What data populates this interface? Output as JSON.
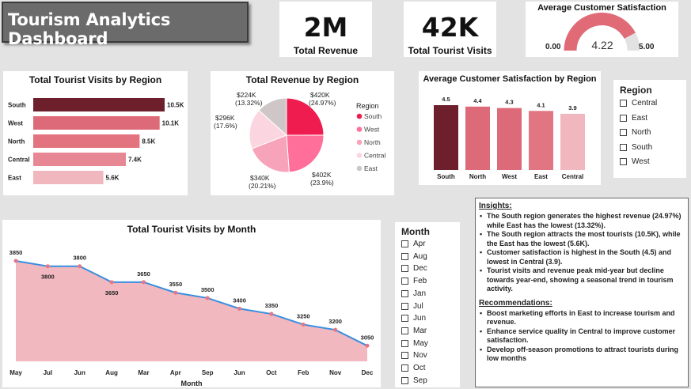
{
  "header": {
    "title": "Tourism Analytics Dashboard"
  },
  "kpis": [
    {
      "value": "2M",
      "label": "Total Revenue"
    },
    {
      "value": "42K",
      "label": "Total Tourist Visits"
    }
  ],
  "gauge": {
    "title": "Average Customer Satisfaction",
    "value": 4.22,
    "value_label": "4.22",
    "min_label": "0.00",
    "max_label": "5.00",
    "min": 0,
    "max": 5,
    "fill_color": "#e06b77",
    "track_color": "#e2e2e2"
  },
  "region_slicer": {
    "title": "Region",
    "items": [
      "Central",
      "East",
      "North",
      "South",
      "West"
    ]
  },
  "month_slicer": {
    "title": "Month",
    "items": [
      "Apr",
      "Aug",
      "Dec",
      "Feb",
      "Jan",
      "Jul",
      "Jun",
      "Mar",
      "May",
      "Nov",
      "Oct",
      "Sep"
    ]
  },
  "insights": {
    "title": "Insights:",
    "items": [
      "The South region generates the highest revenue (24.97%) while East has the lowest (13.32%).",
      "The South region attracts the most tourists (10.5K), while the East has the lowest (5.6K).",
      "Customer satisfaction is highest in the South (4.5) and lowest in Central (3.9).",
      "Tourist visits and revenue peak mid-year but decline towards year-end, showing a seasonal trend in tourism activity."
    ],
    "rec_title": "Recommendations:",
    "recs": [
      "Boost marketing efforts in East to increase tourism and revenue.",
      "Enhance service quality in Central to improve customer satisfaction.",
      "Develop off-season promotions to attract tourists during low months"
    ]
  },
  "chart_data": [
    {
      "id": "visits_by_region",
      "type": "bar",
      "orientation": "horizontal",
      "title": "Total Tourist Visits by Region",
      "categories": [
        "South",
        "West",
        "North",
        "Central",
        "East"
      ],
      "values": [
        10.5,
        10.1,
        8.5,
        7.4,
        5.6
      ],
      "labels": [
        "10.5K",
        "10.1K",
        "8.5K",
        "7.4K",
        "5.6K"
      ],
      "colors": [
        "#6e1f2c",
        "#dd6a78",
        "#e3737f",
        "#e78793",
        "#f0b7bf"
      ],
      "xlim": [
        0,
        10.5
      ]
    },
    {
      "id": "revenue_by_region",
      "type": "pie",
      "title": "Total Revenue by Region",
      "legend_title": "Region",
      "legend_position": "right",
      "categories": [
        "South",
        "West",
        "North",
        "Central",
        "East"
      ],
      "values": [
        24.97,
        23.9,
        20.21,
        17.6,
        13.32
      ],
      "amount_labels": [
        "$420K",
        "$402K",
        "$340K",
        "$296K",
        "$224K"
      ],
      "percent_labels": [
        "(24.97%)",
        "(23.9%)",
        "(20.21%)",
        "(17.6%)",
        "(13.32%)"
      ],
      "colors": [
        "#ee1c4f",
        "#ff6f9a",
        "#f7a3ba",
        "#fbd6e0",
        "#cfc7c7"
      ]
    },
    {
      "id": "satisfaction_by_region",
      "type": "bar",
      "orientation": "vertical",
      "title": "Average Customer Satisfaction by Region",
      "categories": [
        "South",
        "North",
        "West",
        "East",
        "Central"
      ],
      "values": [
        4.5,
        4.4,
        4.3,
        4.1,
        3.9
      ],
      "labels": [
        "4.5",
        "4.4",
        "4.3",
        "4.1",
        "3.9"
      ],
      "colors": [
        "#6e1f2c",
        "#dd6a78",
        "#dd6a78",
        "#e27582",
        "#f0b7bf"
      ],
      "ylim": [
        0,
        4.5
      ]
    },
    {
      "id": "visits_by_month",
      "type": "area",
      "title": "Total Tourist Visits by Month",
      "xlabel": "Month",
      "x": [
        "May",
        "Jul",
        "Jun",
        "Aug",
        "Mar",
        "Apr",
        "Sep",
        "Jun",
        "Oct",
        "Feb",
        "Nov",
        "Dec"
      ],
      "values": [
        3850,
        3800,
        3800,
        3650,
        3650,
        3550,
        3500,
        3400,
        3350,
        3250,
        3200,
        3050
      ],
      "labels": [
        "3850",
        "3800",
        "3800",
        "3650",
        "3650",
        "3550",
        "3500",
        "3400",
        "3350",
        "3250",
        "3200",
        "3050"
      ],
      "line_color": "#3a8fe0",
      "fill_color": "#f2b8bf",
      "marker_color": "#e57684"
    }
  ]
}
